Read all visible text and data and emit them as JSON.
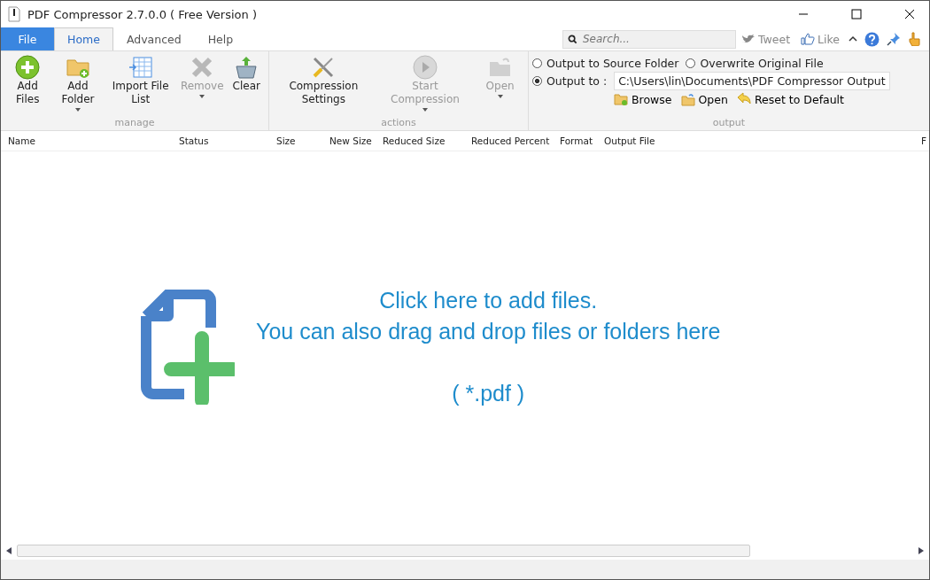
{
  "window": {
    "title": "PDF Compressor 2.7.0.0 ( Free Version )"
  },
  "tabs": [
    {
      "label": "File",
      "kind": "file",
      "selected": false
    },
    {
      "label": "Home",
      "kind": "tab",
      "selected": true
    },
    {
      "label": "Advanced",
      "kind": "tab",
      "selected": false
    },
    {
      "label": "Help",
      "kind": "tab",
      "selected": false
    }
  ],
  "search": {
    "placeholder": "Search..."
  },
  "social": [
    {
      "label": "Tweet"
    },
    {
      "label": "Like"
    }
  ],
  "ribbon_groups": [
    {
      "label": "manage",
      "buttons": [
        {
          "label": "Add Files",
          "disabled": false,
          "dropdown": false
        },
        {
          "label": "Add Folder",
          "disabled": false,
          "dropdown": true
        },
        {
          "label": "Import File List",
          "disabled": false,
          "dropdown": false
        },
        {
          "label": "Remove",
          "disabled": true,
          "dropdown": true
        },
        {
          "label": "Clear",
          "disabled": false,
          "dropdown": false
        }
      ]
    },
    {
      "label": "actions",
      "buttons": [
        {
          "label": "Compression Settings",
          "disabled": false,
          "dropdown": false
        },
        {
          "label": "Start Compression",
          "disabled": true,
          "dropdown": true
        },
        {
          "label": "Open",
          "disabled": true,
          "dropdown": true
        }
      ]
    }
  ],
  "output": {
    "label": "output",
    "options": [
      {
        "label": "Output to Source Folder",
        "selected": false
      },
      {
        "label": "Overwrite Original File",
        "selected": false
      },
      {
        "label": "Output to :",
        "selected": true
      }
    ],
    "path": "C:\\Users\\lin\\Documents\\PDF Compressor Output",
    "links": [
      {
        "label": "Browse"
      },
      {
        "label": "Open"
      },
      {
        "label": "Reset to Default"
      }
    ]
  },
  "table": {
    "columns": [
      "Name",
      "Status",
      "Size",
      "New Size",
      "Reduced Size",
      "Reduced Percent",
      "Format",
      "Output File",
      "F"
    ]
  },
  "drop_zone": {
    "lines": [
      "Click here to add files.",
      "You can also drag and drop files or folders here"
    ],
    "filter": "( *.pdf )"
  }
}
